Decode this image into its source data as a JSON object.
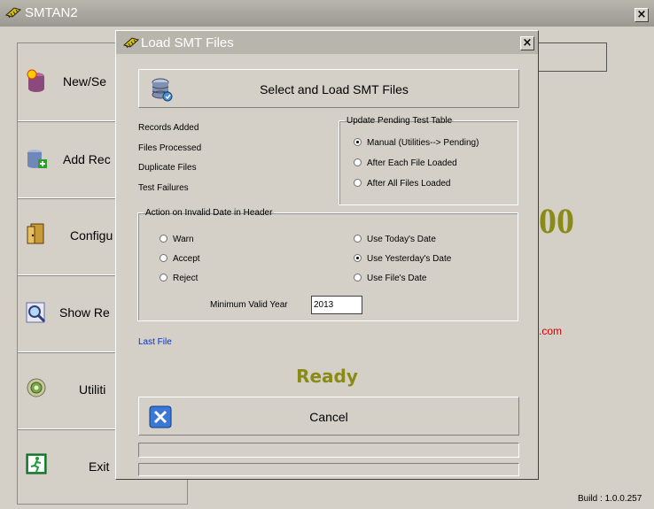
{
  "main": {
    "title": "SMTAN2",
    "close_label": "×",
    "sidebar": [
      {
        "label": "New/Se",
        "icon": "database-new-icon"
      },
      {
        "label": "Add Rec",
        "icon": "database-add-icon"
      },
      {
        "label": "Configu",
        "icon": "door-config-icon"
      },
      {
        "label": "Show Re",
        "icon": "magnifier-report-icon"
      },
      {
        "label": "Utiliti",
        "icon": "target-utility-icon"
      },
      {
        "label": "Exit",
        "icon": "exit-icon"
      }
    ],
    "background_number": "00",
    "background_link": ".com",
    "build": "Build : 1.0.0.257"
  },
  "dialog": {
    "title": "Load SMT Files",
    "close_label": "×",
    "select_button": "Select and Load SMT Files",
    "stats": [
      "Records Added",
      "Files Processed",
      "Duplicate Files",
      "Test Failures"
    ],
    "pending_group": {
      "legend": "Update Pending Test Table",
      "options": [
        {
          "label": "Manual (Utilities--> Pending)",
          "checked": true
        },
        {
          "label": "After Each File Loaded",
          "checked": false
        },
        {
          "label": "After All Files Loaded",
          "checked": false
        }
      ]
    },
    "invalid_date_group": {
      "legend": "Action on Invalid Date in Header",
      "left_options": [
        {
          "label": "Warn",
          "checked": false
        },
        {
          "label": "Accept",
          "checked": false
        },
        {
          "label": "Reject",
          "checked": false
        }
      ],
      "right_options": [
        {
          "label": "Use Today's Date",
          "checked": false
        },
        {
          "label": "Use Yesterday's Date",
          "checked": true
        },
        {
          "label": "Use File's Date",
          "checked": false
        }
      ],
      "min_year_label": "Minimum Valid Year",
      "min_year_value": "2013"
    },
    "last_file_label": "Last File",
    "status": "Ready",
    "cancel_button": "Cancel"
  },
  "colors": {
    "status": "#8a8a16",
    "link": "#0033cc",
    "accent_red": "#cc0000"
  }
}
